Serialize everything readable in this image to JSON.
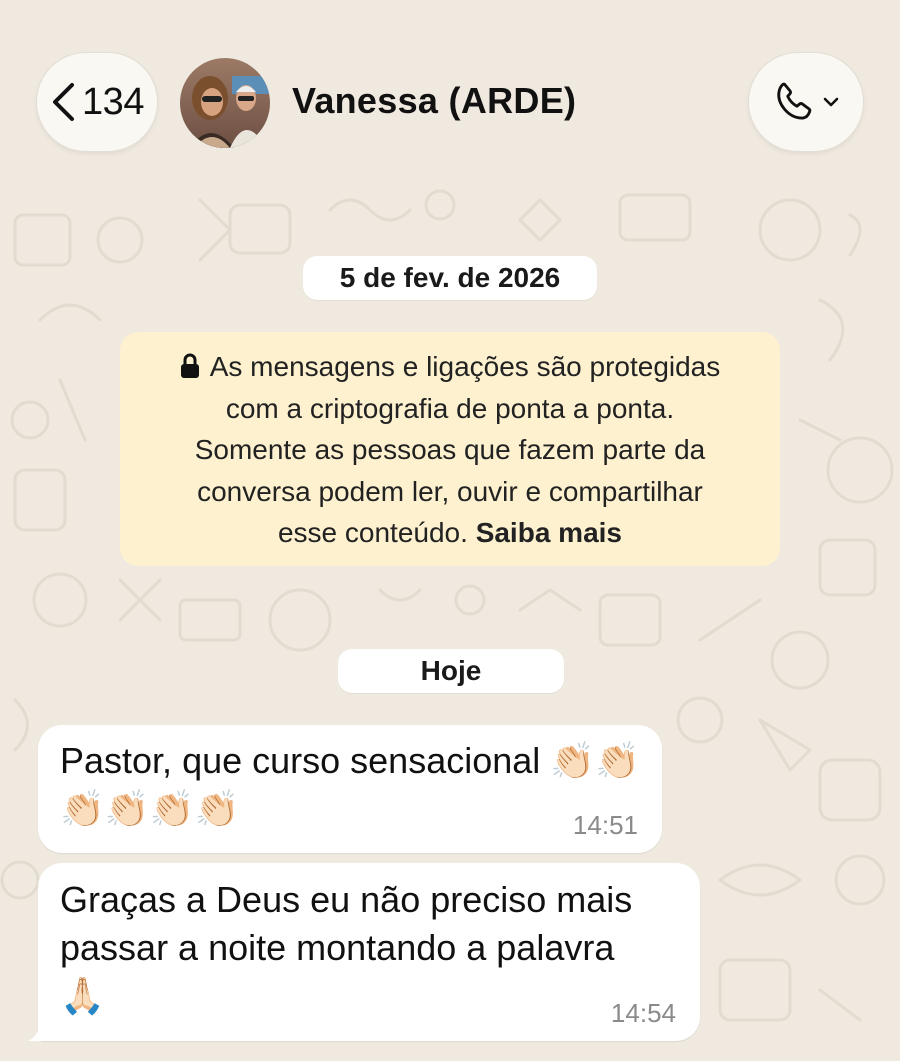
{
  "header": {
    "back_count": "134",
    "contact_name": "Vanessa (ARDE)",
    "icons": {
      "back": "chevron-left-icon",
      "call": "phone-icon",
      "dropdown": "chevron-down-icon"
    }
  },
  "chat": {
    "date_chip": "5 de fev. de 2026",
    "encryption_notice": {
      "line1": "As mensagens e ligações são protegidas",
      "line2": "com a criptografia de ponta a ponta.",
      "line3": "Somente as pessoas que fazem parte da",
      "line4": "conversa podem ler, ouvir e compartilhar",
      "line5_prefix": "esse conteúdo.",
      "link": "Saiba mais",
      "icon": "lock-icon"
    },
    "today_chip": "Hoje",
    "messages": [
      {
        "text": "Pastor, que curso sensacional",
        "emoji": "👏🏻👏🏻👏🏻👏🏻👏🏻👏🏻",
        "time": "14:51"
      },
      {
        "line1": "Graças a Deus eu não preciso mais",
        "line2": "passar a noite montando a palavra",
        "emoji": "🙏🏻",
        "time": "14:54"
      }
    ]
  },
  "colors": {
    "wallpaper": "#efe9df",
    "notice_bg": "#fdf1cf",
    "bubble_bg": "#ffffff",
    "timestamp": "#8a8a8a"
  }
}
